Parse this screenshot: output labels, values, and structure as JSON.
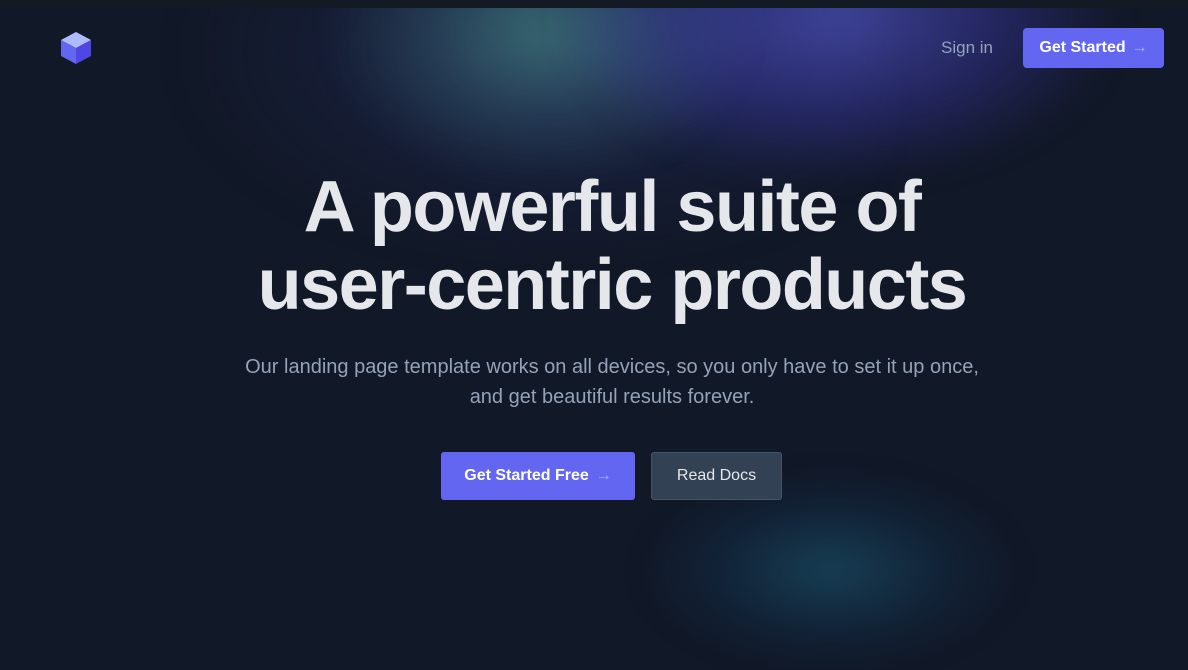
{
  "header": {
    "logo_icon": "cube-logo-icon",
    "signin_label": "Sign in",
    "cta_label": "Get Started",
    "cta_arrow": "→"
  },
  "hero": {
    "title_line1": "A powerful suite of",
    "title_line2": "user-centric products",
    "subtitle_line1": "Our landing page template works on all devices, so you only have to set it up once,",
    "subtitle_line2": "and get beautiful results forever.",
    "primary_label": "Get Started Free",
    "primary_arrow": "→",
    "secondary_label": "Read Docs"
  },
  "colors": {
    "background": "#111827",
    "accent": "#6366f1",
    "heading": "#e5e7eb",
    "muted_text": "#94a3b8",
    "secondary_button": "#334155"
  }
}
